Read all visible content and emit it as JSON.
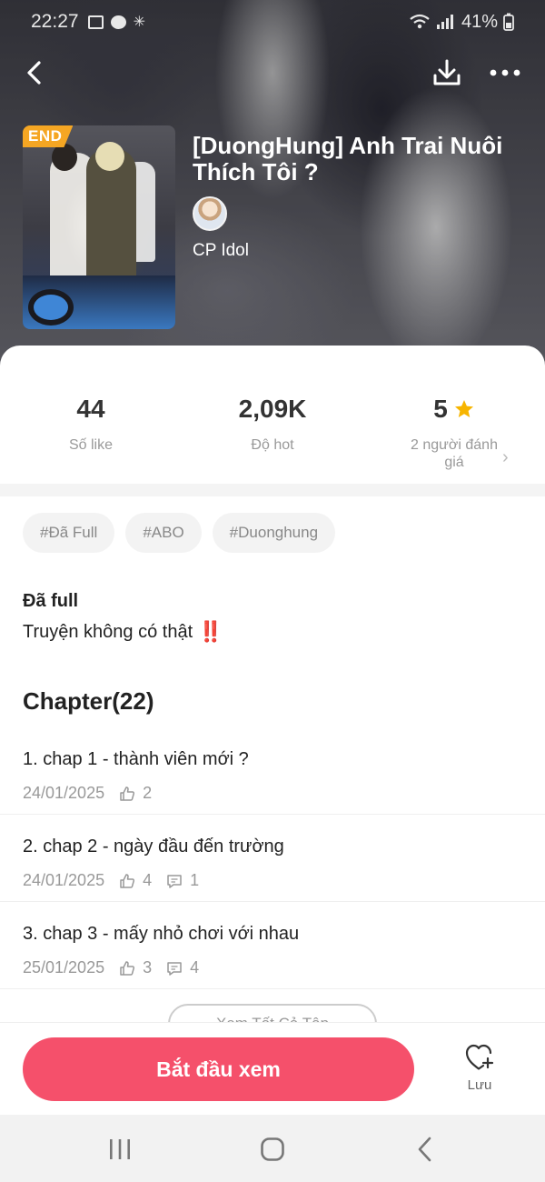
{
  "status_bar": {
    "time": "22:27",
    "battery": "41%"
  },
  "story": {
    "badge": "END",
    "title": "[DuongHung] Anh Trai Nuôi Thích Tôi ?",
    "author": "CP Idol"
  },
  "stats": [
    {
      "value": "44",
      "label": "Số like"
    },
    {
      "value": "2,09K",
      "label": "Độ hot"
    },
    {
      "value": "5",
      "label": "2 người đánh giá"
    }
  ],
  "tags": [
    "#Đã Full",
    "#ABO",
    "#Duonghung"
  ],
  "description": {
    "title": "Đã full",
    "body": "Truyện không có thật",
    "mark": "‼️"
  },
  "chapters_header": "Chapter(22)",
  "chapters": [
    {
      "title": "1. chap 1 - thành viên mới ?",
      "date": "24/01/2025",
      "likes": "2",
      "comments": ""
    },
    {
      "title": "2. chap 2 - ngày đầu đến trường",
      "date": "24/01/2025",
      "likes": "4",
      "comments": "1"
    },
    {
      "title": "3. chap 3 - mấy nhỏ chơi với nhau",
      "date": "25/01/2025",
      "likes": "3",
      "comments": "4"
    }
  ],
  "more_chapters_label": "Xem Tất Cả Tập",
  "bottom": {
    "start_label": "Bắt đầu xem",
    "save_label": "Lưu"
  },
  "colors": {
    "accent": "#f5506b",
    "badge": "#f5a623",
    "star": "#f7b500"
  },
  "icons": [
    "back-icon",
    "download-icon",
    "more-icon",
    "star-icon",
    "like-icon",
    "comment-icon",
    "heart-plus-icon",
    "recent-apps-icon",
    "home-icon",
    "nav-back-icon"
  ]
}
